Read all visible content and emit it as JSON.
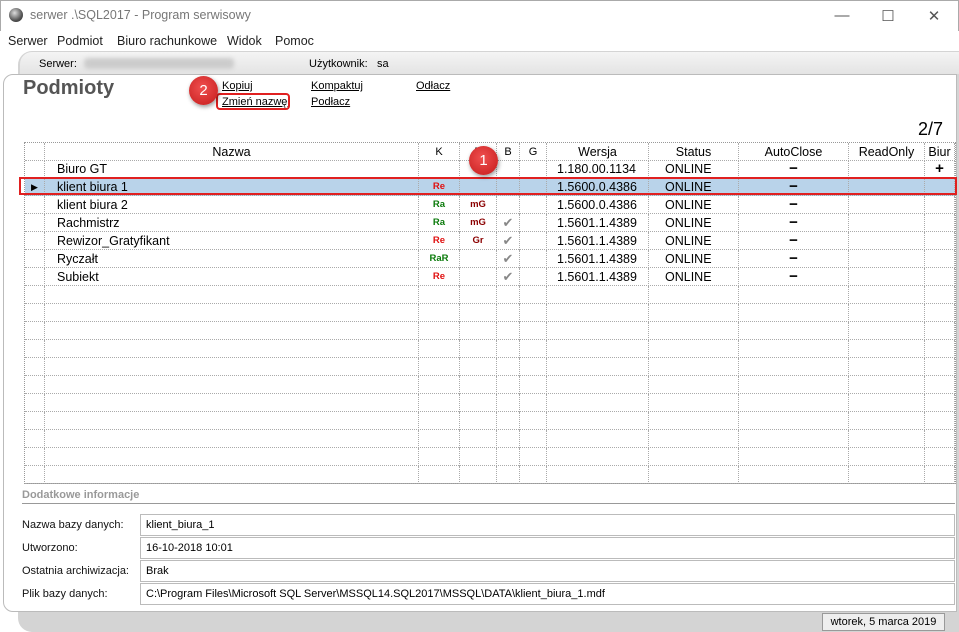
{
  "window": {
    "title": "serwer .\\SQL2017 - Program serwisowy",
    "minimize": "—",
    "maximize": "☐",
    "close": "✕"
  },
  "menu": [
    "Serwer",
    "Podmiot",
    "Biuro rachunkowe",
    "Widok",
    "Pomoc"
  ],
  "serverbar": {
    "server_label": "Serwer:",
    "user_label": "Użytkownik:",
    "user_value": "sa"
  },
  "page_title": "Podmioty",
  "actions": {
    "kopiuj": "Kopiuj",
    "zmien": "Zmień nazwę",
    "kompaktuj": "Kompaktuj",
    "podlacz": "Podłacz",
    "odlacz": "Odłacz"
  },
  "badges": {
    "one": "1",
    "two": "2"
  },
  "counter": "2/7",
  "grid": {
    "columns": [
      "Nazwa",
      "K",
      "P",
      "B",
      "G",
      "Wersja",
      "Status",
      "AutoClose",
      "ReadOnly",
      "Biur"
    ],
    "rows": [
      {
        "name": "Biuro GT",
        "k": "",
        "p": "",
        "b": "",
        "g": "",
        "version": "1.180.00.1134",
        "status": "ONLINE",
        "autoclose": "−",
        "readonly": "",
        "biur": "+"
      },
      {
        "name": "klient biura 1",
        "k": "Re",
        "p": "",
        "b": "",
        "g": "",
        "version": "1.5600.0.4386",
        "status": "ONLINE",
        "autoclose": "−",
        "readonly": "",
        "biur": "",
        "selected": true
      },
      {
        "name": "klient biura 2",
        "k": "Ra",
        "p": "mG",
        "b": "",
        "g": "",
        "version": "1.5600.0.4386",
        "status": "ONLINE",
        "autoclose": "−",
        "readonly": "",
        "biur": ""
      },
      {
        "name": "Rachmistrz",
        "k": "Ra",
        "p": "mG",
        "b": "✔",
        "g": "",
        "version": "1.5601.1.4389",
        "status": "ONLINE",
        "autoclose": "−",
        "readonly": "",
        "biur": ""
      },
      {
        "name": "Rewizor_Gratyfikant",
        "k": "Re",
        "p": "Gr",
        "b": "✔",
        "g": "",
        "version": "1.5601.1.4389",
        "status": "ONLINE",
        "autoclose": "−",
        "readonly": "",
        "biur": ""
      },
      {
        "name": "Ryczałt",
        "k": "RaR",
        "p": "",
        "b": "✔",
        "g": "",
        "version": "1.5601.1.4389",
        "status": "ONLINE",
        "autoclose": "−",
        "readonly": "",
        "biur": ""
      },
      {
        "name": "Subiekt",
        "k": "Re",
        "p": "",
        "b": "✔",
        "g": "",
        "version": "1.5601.1.4389",
        "status": "ONLINE",
        "autoclose": "−",
        "readonly": "",
        "biur": ""
      }
    ]
  },
  "colors": {
    "Re": "#e01010",
    "Ra": "#0a7a0a",
    "RaR": "#0a7a0a",
    "mG": "#8b0000",
    "Gr": "#8b0000",
    "selected": "#b9d3ea",
    "badge": "#d42020"
  },
  "info": {
    "heading": "Dodatkowe informacje",
    "fields": [
      {
        "label": "Nazwa bazy danych:",
        "value": "klient_biura_1"
      },
      {
        "label": "Utworzono:",
        "value": "16-10-2018 10:01"
      },
      {
        "label": "Ostatnia archiwizacja:",
        "value": "Brak"
      },
      {
        "label": "Plik bazy danych:",
        "value": "C:\\Program Files\\Microsoft SQL Server\\MSSQL14.SQL2017\\MSSQL\\DATA\\klient_biura_1.mdf"
      }
    ]
  },
  "statusbar": {
    "date": "wtorek, 5 marca 2019"
  }
}
